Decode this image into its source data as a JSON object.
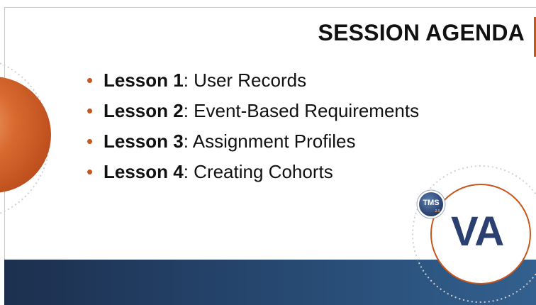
{
  "slide": {
    "title": "SESSION AGENDA",
    "agenda": [
      {
        "lesson": "Lesson 1",
        "topic": ": User Records"
      },
      {
        "lesson": "Lesson 2",
        "topic": ": Event-Based Requirements"
      },
      {
        "lesson": "Lesson 3",
        "topic": ": Assignment Profiles"
      },
      {
        "lesson": "Lesson 4",
        "topic": ": Creating Cohorts"
      }
    ],
    "bullet": "•",
    "logo": {
      "badge_text": "TMS",
      "badge_subtext": "2.0",
      "mark_text": "VA"
    }
  },
  "colors": {
    "accent": "#c8571e",
    "navy": "#2b3f70",
    "band": "#274a73"
  },
  "icons": [
    "tms-badge-icon",
    "va-logo-icon"
  ]
}
